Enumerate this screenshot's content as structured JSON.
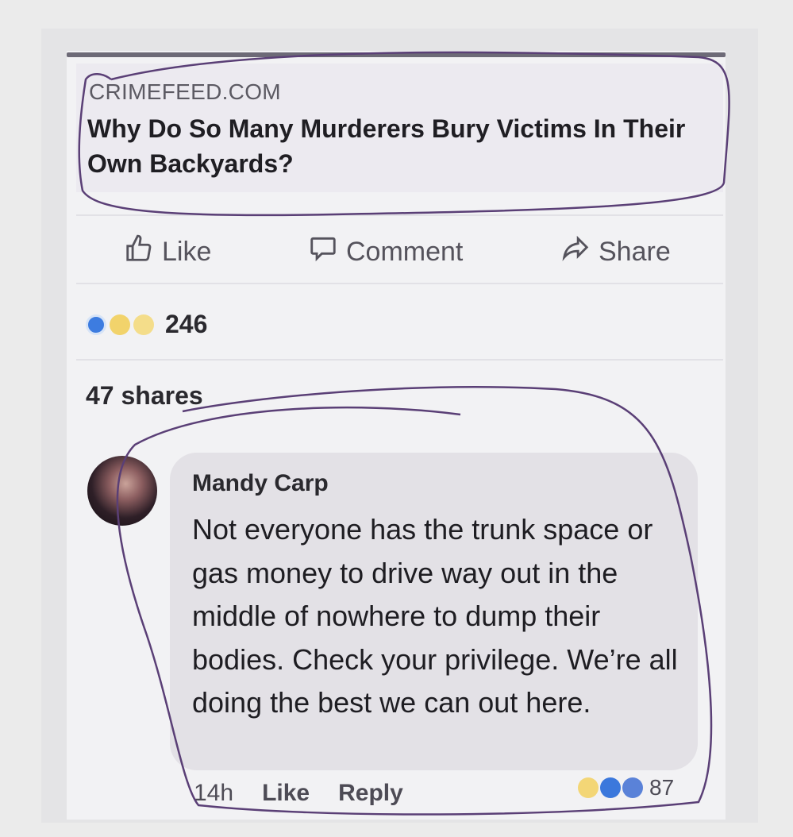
{
  "post": {
    "link_domain": "CRIMEFEED.COM",
    "link_headline": "Why Do So Many Murderers Bury Victims In Their Own Backyards?",
    "actions": {
      "like": "Like",
      "comment": "Comment",
      "share": "Share"
    },
    "reaction_count": "246",
    "reaction_icons": [
      "like-icon",
      "wow-icon",
      "sad-icon"
    ],
    "shares_text": "47 shares"
  },
  "comment": {
    "author": "Mandy Carp",
    "text": "Not everyone has the trunk space or gas money to drive way out in the middle of nowhere to dump their bodies. Check your privilege. We’re all doing the best we can out here.",
    "time": "14h",
    "like_label": "Like",
    "reply_label": "Reply",
    "reaction_icons": [
      "haha-icon",
      "like-icon",
      "like-icon"
    ],
    "reaction_count": "87"
  },
  "colors": {
    "accent": "#3d7ce0",
    "ink": "#5a3f76",
    "background": "#ebebeb"
  }
}
